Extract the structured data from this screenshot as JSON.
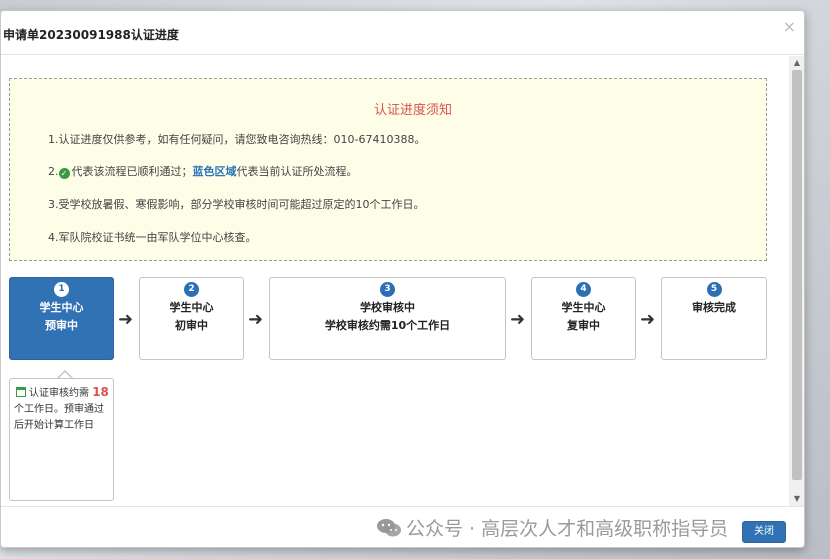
{
  "modal": {
    "title": "申请单20230091988认证进度",
    "close_symbol": "×"
  },
  "notice": {
    "title": "认证进度须知",
    "line1": "1.认证进度仅供参考，如有任何疑问，请您致电咨询热线：010-67410388。",
    "line2_prefix": "2.",
    "line2_mid": "代表该流程已顺利通过；",
    "line2_blue": "蓝色区域",
    "line2_suffix": "代表当前认证所处流程。",
    "line3": "3.受学校放暑假、寒假影响，部分学校审核时间可能超过原定的10个工作日。",
    "line4": "4.军队院校证书统一由军队学位中心核查。"
  },
  "steps": [
    {
      "num": "1",
      "l1": "学生中心",
      "l2": "预审中",
      "active": true
    },
    {
      "num": "2",
      "l1": "学生中心",
      "l2": "初审中",
      "active": false
    },
    {
      "num": "3",
      "l1": "学校审核中",
      "l2": "学校审核约需10个工作日",
      "active": false
    },
    {
      "num": "4",
      "l1": "学生中心",
      "l2": "复审中",
      "active": false
    },
    {
      "num": "5",
      "l1": "审核完成",
      "l2": "",
      "active": false
    }
  ],
  "arrow_symbol": "➜",
  "tip": {
    "prefix": "认证审核约需",
    "days": "18",
    "rest": "个工作日。预审通过后开始计算工作日"
  },
  "footer": {
    "close_label": "关闭"
  },
  "watermark": {
    "text": "公众号 · 高层次人才和高级职称指导员"
  },
  "colors": {
    "accent": "#3172b4",
    "notice_bg": "#fdfde8",
    "notice_title": "#d9534f",
    "success": "#3a9a43"
  }
}
